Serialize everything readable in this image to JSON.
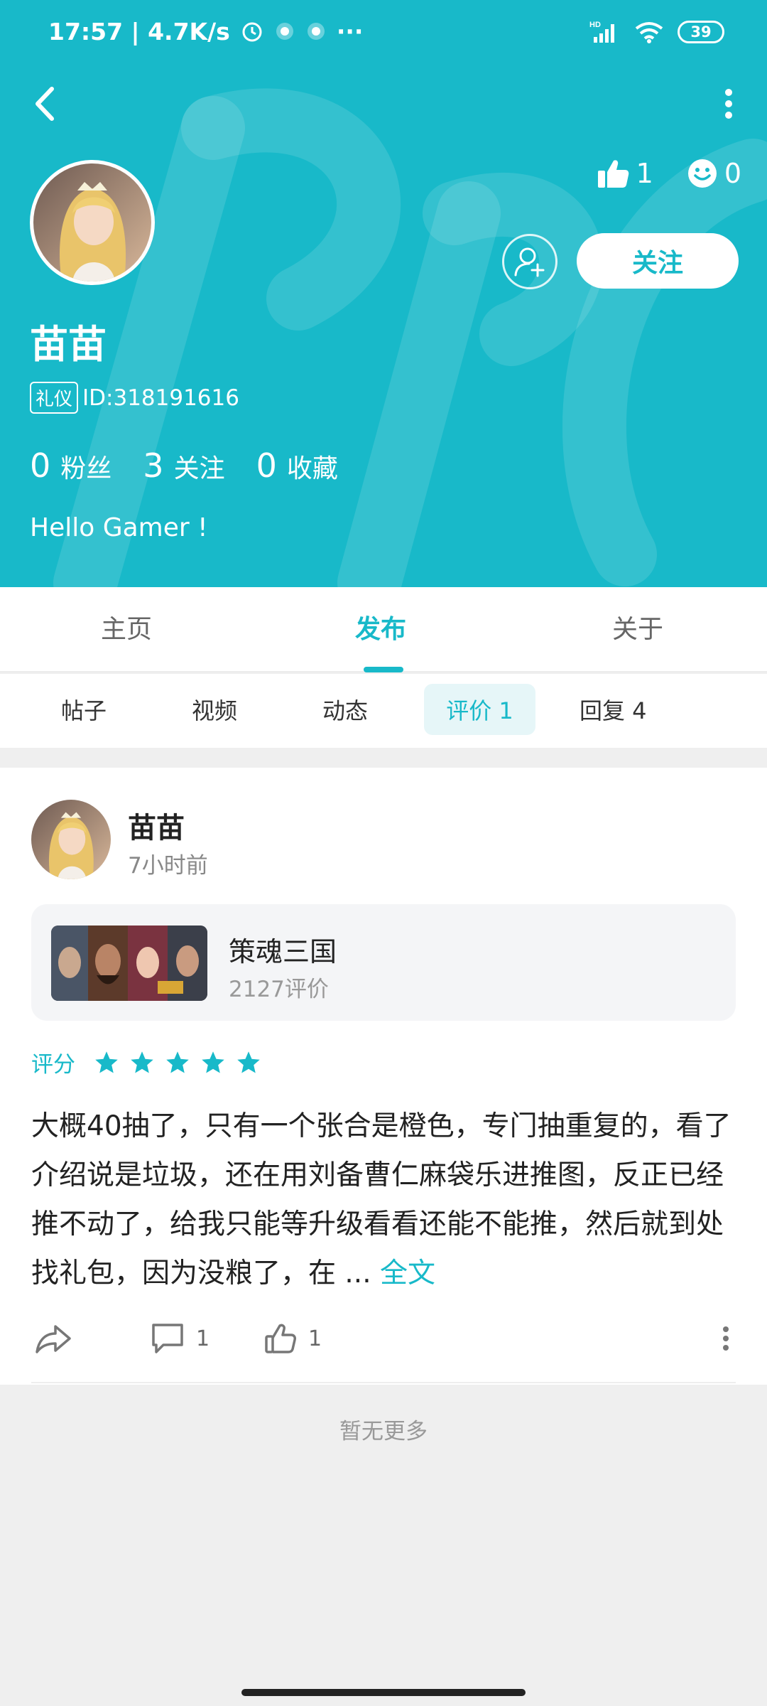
{
  "status_bar": {
    "time_speed": "17:57 | 4.7K/s",
    "more": "···",
    "network_tag": "HD",
    "battery": "39"
  },
  "profile": {
    "like_count": "1",
    "smile_count": "0",
    "follow_button": "关注",
    "name": "苗苗",
    "badge": "礼仪",
    "id_text": "ID:318191616",
    "fans_count": "0",
    "fans_label": "粉丝",
    "following_count": "3",
    "following_label": "关注",
    "favorites_count": "0",
    "favorites_label": "收藏",
    "bio": "Hello Gamer !"
  },
  "main_tabs": [
    {
      "label": "主页",
      "active": false
    },
    {
      "label": "发布",
      "active": true
    },
    {
      "label": "关于",
      "active": false
    }
  ],
  "sub_tabs": [
    {
      "label": "帖子",
      "active": false
    },
    {
      "label": "视频",
      "active": false
    },
    {
      "label": "动态",
      "active": false
    },
    {
      "label": "评价 1",
      "active": true
    },
    {
      "label": "回复 4",
      "active": false
    }
  ],
  "post": {
    "user": "苗苗",
    "time": "7小时前",
    "game_name": "策魂三国",
    "game_reviews": "2127评价",
    "rating_label": "评分",
    "rating": 5,
    "text": "大概40抽了，只有一个张合是橙色，专门抽重复的，看了介绍说是垃圾，还在用刘备曹仁麻袋乐进推图，反正已经推不动了，给我只能等升级看看还能不能推，然后就到处找礼包，因为没粮了，在 ... ",
    "full_text_link": "全文",
    "comment_count": "1",
    "like_count": "1"
  },
  "footer": {
    "no_more": "暂无更多"
  },
  "colors": {
    "accent": "#18b9c9",
    "header_bg": "#18b9c9",
    "page_bg": "#efefef"
  }
}
